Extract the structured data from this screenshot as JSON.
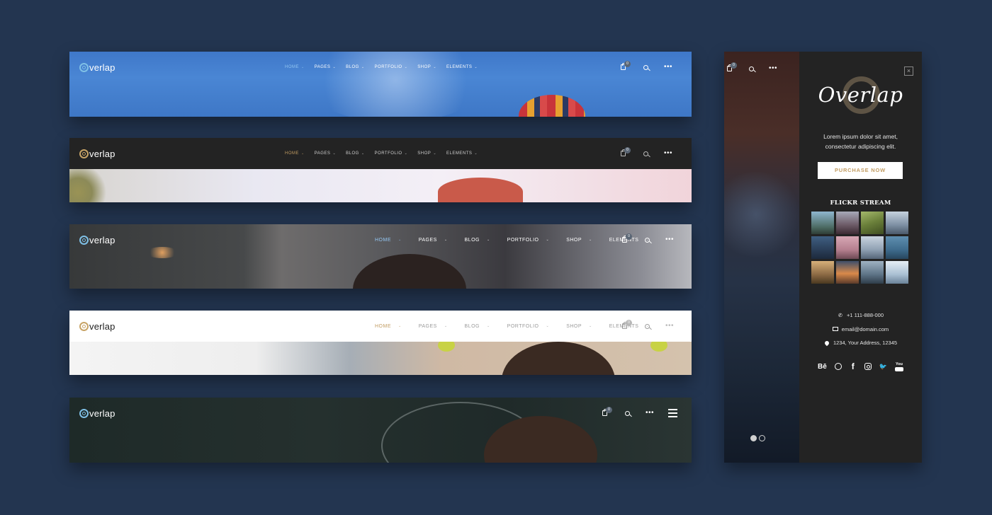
{
  "logo": {
    "text": "verlap",
    "accent_colors": {
      "blue": "#7fc0e6",
      "gold": "#c8a467"
    }
  },
  "nav_items": [
    "HOME",
    "PAGES",
    "BLOG",
    "PORTFOLIO",
    "SHOP",
    "ELEMENTS"
  ],
  "caret": "⌄",
  "cart_count": "0",
  "dots": "•••",
  "colors": {
    "background": "#233550",
    "accent_gold": "#c29d63",
    "home_active_blue": "#93c6f2"
  },
  "panel": {
    "logo_text": "Overlap",
    "close_glyph": "×",
    "intro_line1": "Lorem ipsum dolor sit amet,",
    "intro_line2": "consectetur adipiscing elit.",
    "purchase_label": "PURCHASE NOW",
    "flickr_title": "FLICKR STREAM",
    "contacts": {
      "phone": "+1 111-888-000",
      "email": "email@domain.com",
      "address": "1234, Your Address, 12345"
    },
    "socials": {
      "behance": "Bē",
      "facebook": "f",
      "twitter": "🐦",
      "youtube": "You"
    },
    "icons": [
      "phone-icon",
      "mail-icon",
      "location-pin-icon",
      "behance-icon",
      "dribbble-icon",
      "facebook-icon",
      "instagram-icon",
      "twitter-icon",
      "youtube-icon"
    ]
  }
}
